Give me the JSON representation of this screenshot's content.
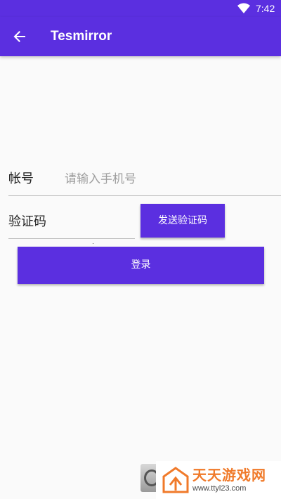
{
  "status_bar": {
    "time": "7:42",
    "wifi_icon": "wifi-icon"
  },
  "app_bar": {
    "title": "Tesmirror",
    "back_icon": "arrow-back-icon"
  },
  "form": {
    "account_label": "帐号",
    "account_placeholder": "请输入手机号",
    "account_value": "",
    "code_label": "验证码",
    "code_value": "",
    "send_code_label": "发送验证码",
    "login_label": "登录"
  },
  "watermark": {
    "name": "天天游戏网",
    "url": "www.ttyl23.com"
  },
  "colors": {
    "primary": "#5b2fe0",
    "background": "#fafafa",
    "watermark_orange": "#f07a2a"
  }
}
